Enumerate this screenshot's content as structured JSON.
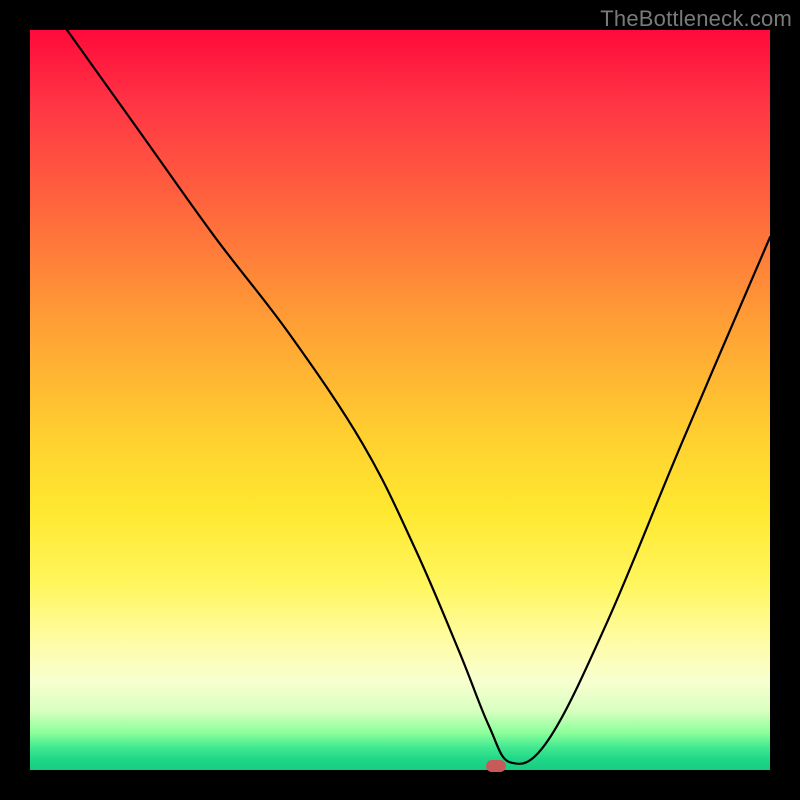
{
  "watermark": "TheBottleneck.com",
  "chart_data": {
    "type": "line",
    "title": "",
    "xlabel": "",
    "ylabel": "",
    "xlim": [
      0,
      100
    ],
    "ylim": [
      0,
      100
    ],
    "series": [
      {
        "name": "curve",
        "x": [
          5,
          15,
          25,
          35,
          45,
          52,
          58,
          62,
          65,
          70,
          78,
          88,
          100
        ],
        "values": [
          100,
          86,
          72,
          59,
          44,
          30,
          16,
          6,
          1,
          4,
          20,
          44,
          72
        ]
      }
    ],
    "marker": {
      "x": 63,
      "y": 0.5
    },
    "background_gradient": {
      "top": "#ff0a3a",
      "middle": "#ffe830",
      "bottom": "#18cc82"
    }
  }
}
